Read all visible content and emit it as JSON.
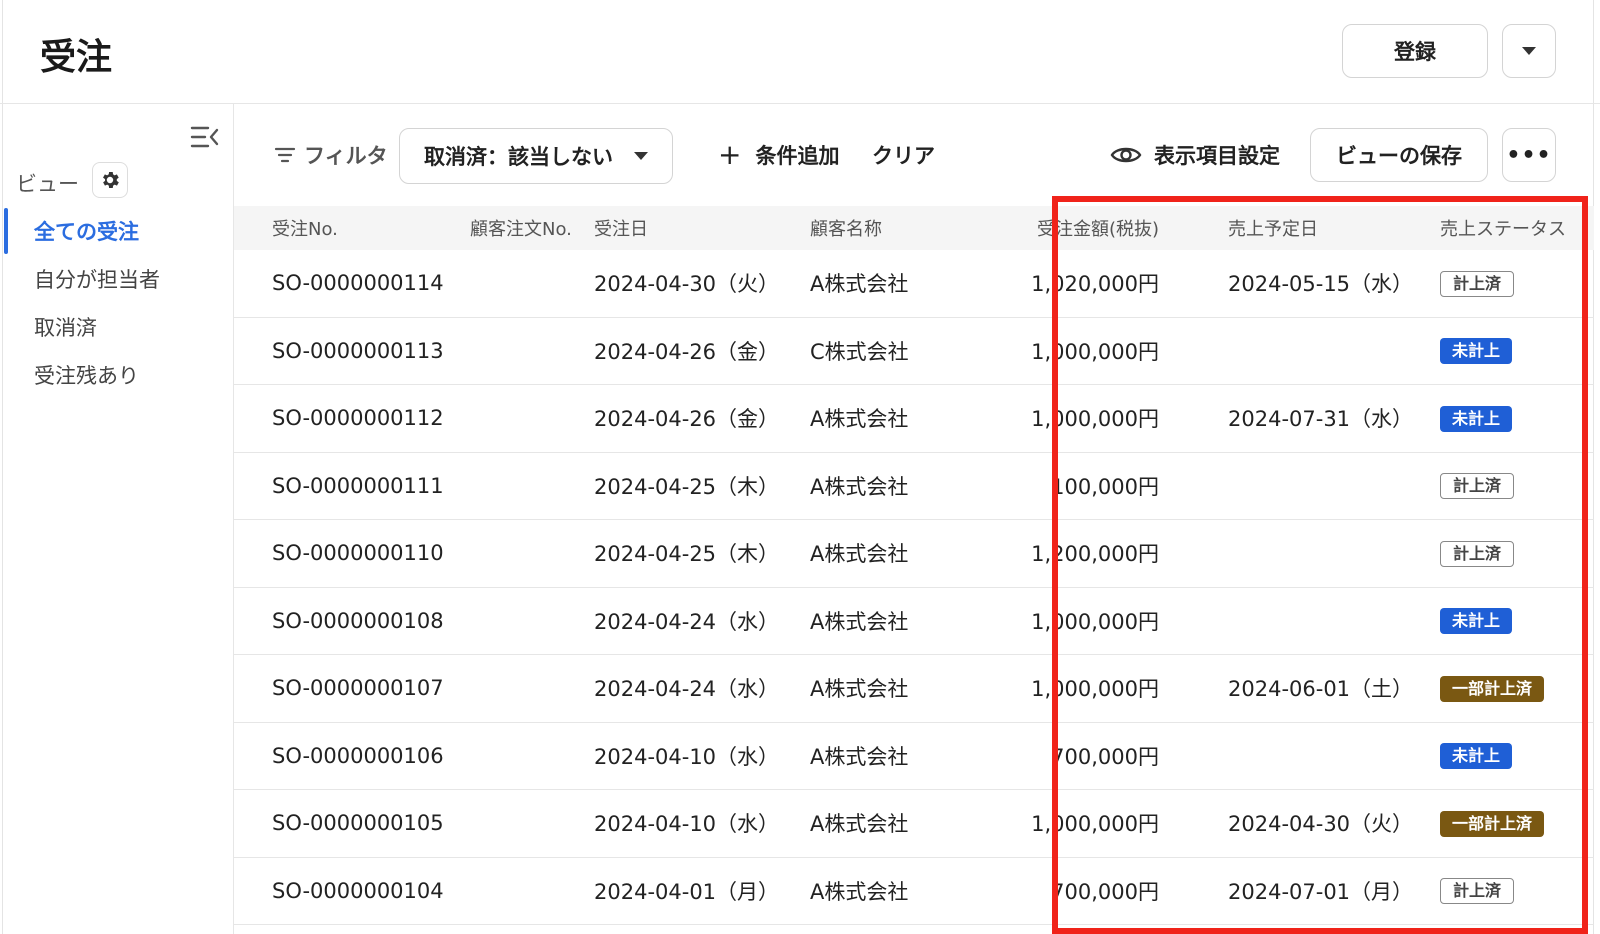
{
  "header": {
    "title": "受注",
    "register_label": "登録"
  },
  "sidebar": {
    "view_label": "ビュー",
    "items": [
      {
        "label": "全ての受注",
        "active": true
      },
      {
        "label": "自分が担当者",
        "active": false
      },
      {
        "label": "取消済",
        "active": false
      },
      {
        "label": "受注残あり",
        "active": false
      }
    ]
  },
  "toolbar": {
    "filter_label": "フィルタ",
    "filter_chip": "取消済：該当しない",
    "add_condition": "条件追加",
    "clear": "クリア",
    "column_settings": "表示項目設定",
    "save_view": "ビューの保存",
    "more": "•••"
  },
  "table": {
    "columns": [
      "受注No.",
      "顧客注文No.",
      "受注日",
      "顧客名称",
      "受注金額(税抜)",
      "売上予定日",
      "売上ステータス"
    ],
    "rows": [
      {
        "no": "SO-0000000114",
        "cust_no": "",
        "date": "2024-04-30（火）",
        "name": "A株式会社",
        "amount": "1,020,000円",
        "sales_date": "2024-05-15（水）",
        "status": "計上済",
        "status_type": "done"
      },
      {
        "no": "SO-0000000113",
        "cust_no": "",
        "date": "2024-04-26（金）",
        "name": "C株式会社",
        "amount": "1,000,000円",
        "sales_date": "",
        "status": "未計上",
        "status_type": "todo"
      },
      {
        "no": "SO-0000000112",
        "cust_no": "",
        "date": "2024-04-26（金）",
        "name": "A株式会社",
        "amount": "1,000,000円",
        "sales_date": "2024-07-31（水）",
        "status": "未計上",
        "status_type": "todo"
      },
      {
        "no": "SO-0000000111",
        "cust_no": "",
        "date": "2024-04-25（木）",
        "name": "A株式会社",
        "amount": "100,000円",
        "sales_date": "",
        "status": "計上済",
        "status_type": "done"
      },
      {
        "no": "SO-0000000110",
        "cust_no": "",
        "date": "2024-04-25（木）",
        "name": "A株式会社",
        "amount": "1,200,000円",
        "sales_date": "",
        "status": "計上済",
        "status_type": "done"
      },
      {
        "no": "SO-0000000108",
        "cust_no": "",
        "date": "2024-04-24（水）",
        "name": "A株式会社",
        "amount": "1,000,000円",
        "sales_date": "",
        "status": "未計上",
        "status_type": "todo"
      },
      {
        "no": "SO-0000000107",
        "cust_no": "",
        "date": "2024-04-24（水）",
        "name": "A株式会社",
        "amount": "1,000,000円",
        "sales_date": "2024-06-01（土）",
        "status": "一部計上済",
        "status_type": "partial"
      },
      {
        "no": "SO-0000000106",
        "cust_no": "",
        "date": "2024-04-10（水）",
        "name": "A株式会社",
        "amount": "700,000円",
        "sales_date": "",
        "status": "未計上",
        "status_type": "todo"
      },
      {
        "no": "SO-0000000105",
        "cust_no": "",
        "date": "2024-04-10（水）",
        "name": "A株式会社",
        "amount": "1,000,000円",
        "sales_date": "2024-04-30（火）",
        "status": "一部計上済",
        "status_type": "partial"
      },
      {
        "no": "SO-0000000104",
        "cust_no": "",
        "date": "2024-04-01（月）",
        "name": "A株式会社",
        "amount": "700,000円",
        "sales_date": "2024-07-01（月）",
        "status": "計上済",
        "status_type": "done"
      }
    ]
  },
  "colors": {
    "accent": "#2b6de0",
    "badge_todo": "#1f5fd6",
    "badge_partial": "#7a5812",
    "highlight": "#f0231a"
  },
  "icons": {
    "collapse": "sidebar-collapse-icon",
    "gear": "gear-icon",
    "filter": "filter-icon",
    "eye": "eye-icon",
    "caret": "caret-down-icon",
    "plus": "plus-icon"
  }
}
